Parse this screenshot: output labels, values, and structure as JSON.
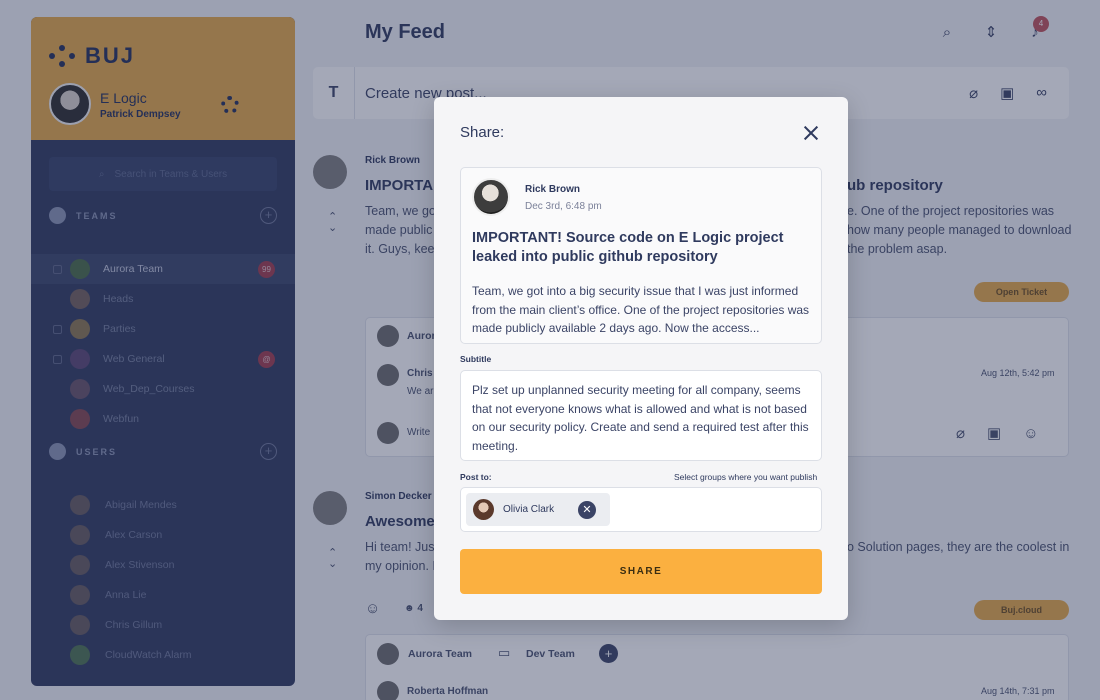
{
  "brand": {
    "name": "BUJ"
  },
  "user": {
    "org": "E Logic",
    "name": "Patrick Dempsey"
  },
  "sidebar": {
    "search_placeholder": "Search in Teams & Users",
    "teams_label": "TEAMS",
    "users_label": "USERS",
    "teams": [
      {
        "name": "Aurora Team",
        "badge": "99",
        "locked": true,
        "active": true
      },
      {
        "name": "Heads",
        "badge": "",
        "locked": false
      },
      {
        "name": "Parties",
        "badge": "",
        "locked": true
      },
      {
        "name": "Web General",
        "badge": "@",
        "locked": true
      },
      {
        "name": "Web_Dep_Courses",
        "badge": "",
        "locked": false
      },
      {
        "name": "Webfun",
        "badge": "",
        "locked": false
      }
    ],
    "users": [
      "Abigail Mendes",
      "Alex Carson",
      "Alex Stivenson",
      "Anna Lie",
      "Chris Gillum",
      "CloudWatch Alarm"
    ]
  },
  "header": {
    "title": "My Feed",
    "notification_count": "4"
  },
  "composer": {
    "placeholder": "Create new post..."
  },
  "feed": {
    "post1": {
      "author": "Rick Brown",
      "title_left": "IMPORTA",
      "title_right": "ub repository",
      "body_left": [
        "Team, we got",
        "made public",
        "it. Guys, keep"
      ],
      "body_right": [
        "e.  One of the project repositories was",
        "how many people managed to download",
        "the problem asap."
      ],
      "tag": "Open Ticket",
      "comment_box_team": "Auror",
      "comment_author": "Chris",
      "comment_text": "We ar",
      "comment_date": "Aug 12th, 5:42 pm",
      "reply_placeholder": "Write"
    },
    "post2": {
      "author": "Simon Decker",
      "title_left": "Awesome",
      "body_left": [
        "Hi team! Jus",
        "my opinion. I"
      ],
      "body_right": "o Solution pages, they are the coolest in",
      "tag": "Buj.cloud",
      "reaction_count": "4",
      "teams": [
        "Aurora Team",
        "Dev Team"
      ],
      "comment_author": "Roberta Hoffman",
      "comment_date": "Aug 14th, 7:31 pm"
    }
  },
  "modal": {
    "title": "Share:",
    "preview": {
      "author": "Rick Brown",
      "date": "Dec 3rd, 6:48 pm",
      "title": "IMPORTANT! Source code on E Logic project leaked into public github repository",
      "body": "Team, we got into a big security issue that I was just informed from the main client’s office.  One of the project repositories was made publicly available 2 days ago. Now the access..."
    },
    "subtitle_label": "Subtitle",
    "subtitle_value": "Plz set up unplanned security meeting for all company, seems that not everyone knows what is allowed and what is not based on our security policy. Create and send a required test after this meeting.",
    "post_to_label": "Post to:",
    "post_to_hint": "Select groups where you want publish",
    "recipients": [
      {
        "name": "Olivia Clark"
      }
    ],
    "share_label": "SHARE"
  }
}
